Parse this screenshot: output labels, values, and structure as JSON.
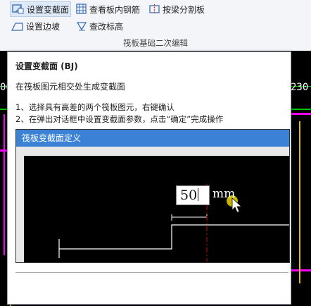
{
  "ribbon": {
    "set_section": "设置变截面",
    "view_rebar": "查看板内钢筋",
    "split_by_beam": "按梁分割板",
    "set_slope": "设置边坡",
    "edit_elevation": "查改标高",
    "group_label": "筏板基础二次编辑"
  },
  "cad_edge_text": {
    "left": "00",
    "right": "230"
  },
  "tooltip": {
    "title": "设置变截面 (BJ)",
    "description": "在筏板图元相交处生成变截面",
    "step1": "1、选择具有高差的两个筏板图元，右键确认",
    "step2": "2、在弹出对话框中设置变截面参数，点击“确定”完成操作",
    "demo_title": "筏板变截面定义",
    "demo_value": "50",
    "demo_unit": "mm"
  },
  "colors": {
    "accent_blue": "#3b82d6",
    "cad_background": "#000000",
    "cad_green": "#00c000",
    "cad_magenta": "#ff00ff",
    "cad_yellow": "#e0c000",
    "cursor_yellow": "#c8b400"
  }
}
